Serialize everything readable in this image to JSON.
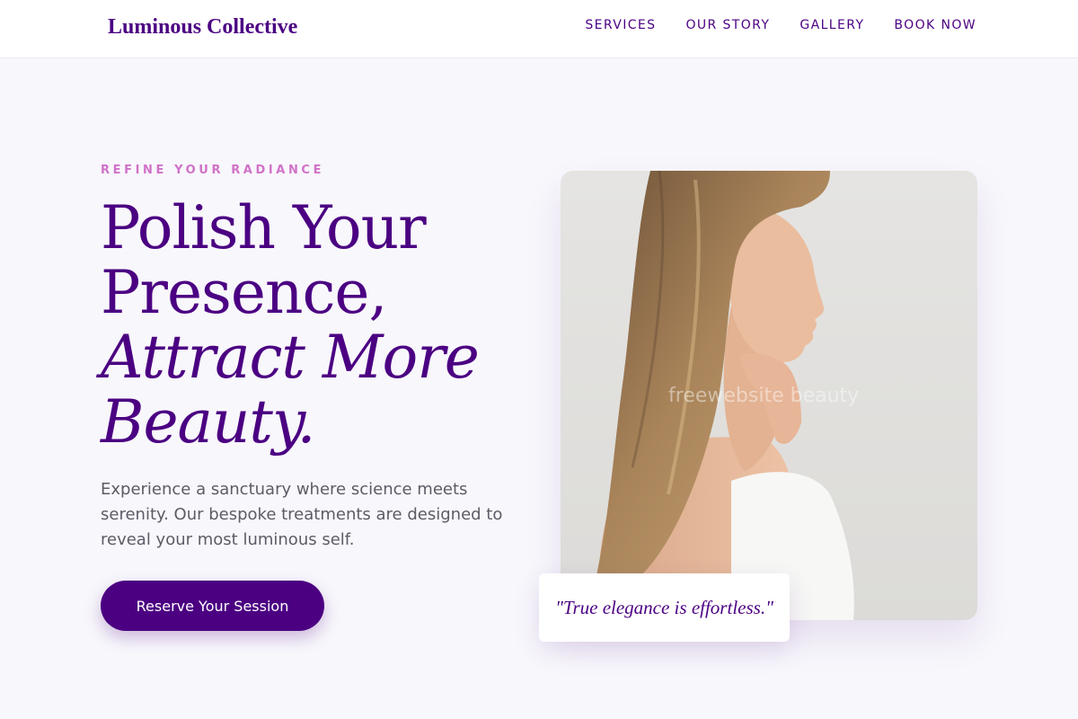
{
  "header": {
    "brand": "Luminous Collective",
    "nav": [
      {
        "label": "SERVICES"
      },
      {
        "label": "OUR STORY"
      },
      {
        "label": "GALLERY"
      },
      {
        "label": "BOOK NOW"
      }
    ]
  },
  "hero": {
    "eyebrow": "REFINE YOUR RADIANCE",
    "headline": {
      "line1": "Polish Your",
      "line2": "Presence,",
      "line3": "Attract More",
      "line4": "Beauty."
    },
    "lead": "Experience a sanctuary where science meets serenity. Our bespoke treatments are designed to reveal your most luminous self.",
    "cta_label": "Reserve Your Session",
    "photo_alt": "Woman with long hair in profile",
    "watermark": "freewebsite beauty",
    "quote": "\"True elegance is effortless.\""
  },
  "colors": {
    "brand": "#4b0082",
    "accent": "#d072c8",
    "background": "#f8f7fc",
    "body_text": "#5c5c66"
  }
}
